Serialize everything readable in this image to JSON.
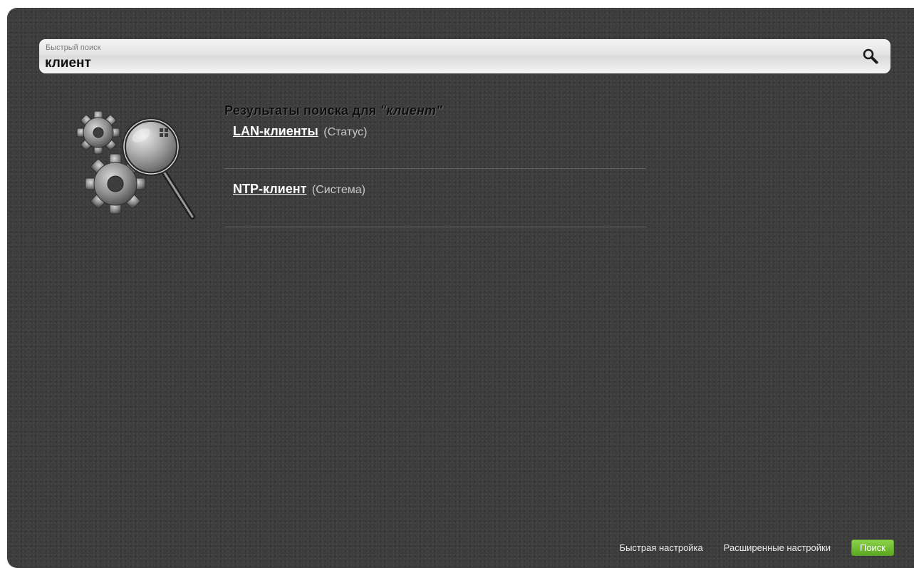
{
  "search": {
    "caption": "Быстрый поиск",
    "value": "клиент",
    "icon": "search-icon"
  },
  "hero": {
    "icon": "gears-magnifier-icon"
  },
  "results": {
    "title_prefix": "Результаты поиска для ",
    "term": "\"клиент\"",
    "items": [
      {
        "label": "LAN-клиенты",
        "section": "(Статус)"
      },
      {
        "label": "NTP-клиент",
        "section": "(Система)"
      }
    ]
  },
  "footer": {
    "quick_setup": "Быстрая настройка",
    "advanced_settings": "Расширенные настройки",
    "search_button": "Поиск"
  },
  "colors": {
    "background": "#3d3d3d",
    "accent_button": "#6cba2e",
    "link": "#ffffff"
  }
}
